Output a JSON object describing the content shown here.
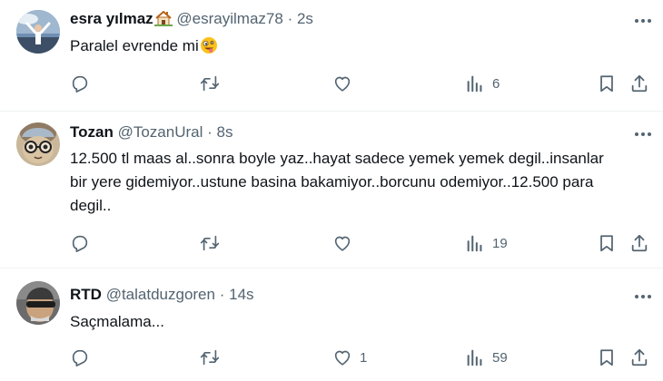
{
  "tweets": [
    {
      "name": "esra yılmaz",
      "handle": "@esrayilmaz78",
      "separator": "·",
      "time": "2s",
      "text": "Paralel evrende mi",
      "reply_count": "",
      "retweet_count": "",
      "like_count": "",
      "views_count": "6"
    },
    {
      "name": "Tozan",
      "handle": "@TozanUral",
      "separator": "·",
      "time": "8s",
      "text": "12.500 tl  maas al..sonra boyle yaz..hayat sadece yemek yemek degil..insanlar bir yere gidemiyor..ustune basina bakamiyor..borcunu odemiyor..12.500 para degil..",
      "reply_count": "",
      "retweet_count": "",
      "like_count": "",
      "views_count": "19"
    },
    {
      "name": "RTD",
      "handle": "@talatduzgoren",
      "separator": "·",
      "time": "14s",
      "text": "Saçmalama...",
      "reply_count": "",
      "retweet_count": "",
      "like_count": "1",
      "views_count": "59"
    }
  ],
  "colors": {
    "text": "#0f1419",
    "secondary": "#536471",
    "divider": "#eff3f4"
  },
  "icons": [
    "reply-icon",
    "retweet-icon",
    "like-icon",
    "views-icon",
    "bookmark-icon",
    "share-icon",
    "more-icon",
    "house-emoji",
    "zany-face-emoji"
  ]
}
